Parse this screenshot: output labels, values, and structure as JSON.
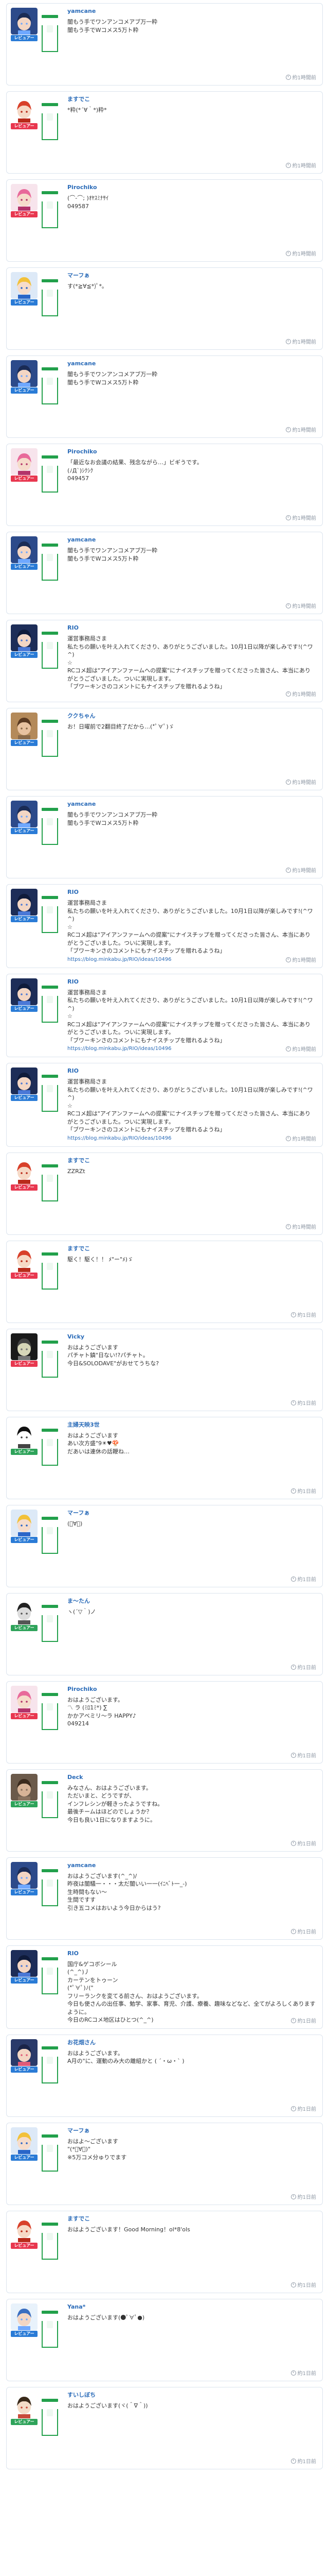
{
  "feed": {
    "posts": [
      {
        "user": "yamcane",
        "rank": "レビュアー",
        "rank_color": "blue",
        "avatar": "anime-blue",
        "msg": "闇もう手でワンアンコメアブ万一粋\n闇もう手でWコメス5万ト粋",
        "link": "",
        "ts": "約1時間前"
      },
      {
        "user": "ますでこ",
        "rank": "レビュアー",
        "rank_color": "red",
        "avatar": "red-hair",
        "msg": "*粋(*´∀｀*)粋*",
        "link": "",
        "ts": "約1時間前"
      },
      {
        "user": "Pirochiko",
        "rank": "レビュアー",
        "rank_color": "red",
        "avatar": "anime-pink",
        "msg": "(⌒-⌒; )ｵﾔｽﾐﾅｻｲ\n049587",
        "link": "",
        "ts": "約1時間前"
      },
      {
        "user": "マーフぁ",
        "rank": "レビュアー",
        "rank_color": "blue",
        "avatar": "anime-yellow",
        "msg": "す(*≧∀≦*)ﾟ*｡",
        "link": "",
        "ts": "約1時間前"
      },
      {
        "user": "yamcane",
        "rank": "レビュアー",
        "rank_color": "blue",
        "avatar": "anime-blue",
        "msg": "闇もう手でワンアンコメアブ万一粋\n闇もう手でWコメス5万ト粋",
        "link": "",
        "ts": "約1時間前"
      },
      {
        "user": "Pirochiko",
        "rank": "レビュアー",
        "rank_color": "red",
        "avatar": "anime-pink",
        "msg": "「最近なお会議の結果、残念ながら…」ビギうです。\n(ﾉД`)ｼｸｼｸ\n049457",
        "link": "",
        "ts": "約1時間前"
      },
      {
        "user": "yamcane",
        "rank": "レビュアー",
        "rank_color": "blue",
        "avatar": "anime-blue",
        "msg": "闇もう手でワンアンコメアブ万一粋\n闇もう手でWコメス5万ト粋",
        "link": "",
        "ts": "約1時間前"
      },
      {
        "user": "RIO",
        "rank": "レビュアー",
        "rank_color": "blue",
        "avatar": "anime-navy",
        "msg": "運営事務局さま\n私たちの願いを叶え入れてくださり、ありがとうございました。10月1日以降が楽しみです!(^ワ^)\n☆\nRCコメ超は\"アイアンファームへの提案\"にナイスチップを贈ってくださった皆さん、本当にありがとうございました。ついに実現します。\n「ブワーキンさのコメントにもナイスチップを贈れるようね」",
        "link": "",
        "ts": "約1時間前"
      },
      {
        "user": "ククちゃん",
        "rank": "レビュアー",
        "rank_color": "blue",
        "avatar": "photo-child",
        "msg": "お！日曜前で2翻目終了だから…(*ﾟ∀ﾟ)ゞ",
        "link": "",
        "ts": "約1時間前"
      },
      {
        "user": "yamcane",
        "rank": "レビュアー",
        "rank_color": "blue",
        "avatar": "anime-blue",
        "msg": "闇もう手でワンアンコメアブ万一粋\n闇もう手でWコメス5万ト粋",
        "link": "",
        "ts": "約1時間前"
      },
      {
        "user": "RIO",
        "rank": "レビュアー",
        "rank_color": "blue",
        "avatar": "anime-navy",
        "msg": "運営事務局さま\n私たちの願いを叶え入れてくださり、ありがとうございました。10月1日以降が楽しみです!(^ワ^)\n☆\nRCコメ超は\"アイアンファームへの提案\"にナイスチップを贈ってくださった皆さん、本当にありがとうございました。ついに実現します。\n「ブワーキンさのコメントにもナイスチップを贈れるようね」",
        "link": "https://blog.minkabu.jp/RIO/ideas/10496",
        "ts": "約1時間前"
      },
      {
        "user": "RIO",
        "rank": "レビュアー",
        "rank_color": "blue",
        "avatar": "anime-navy",
        "msg": "運営事務局さま\n私たちの願いを叶え入れてくださり、ありがとうございました。10月1日以降が楽しみです!(^ワ^)\n☆\nRCコメ超は\"アイアンファームへの提案\"にナイスチップを贈ってくださった皆さん、本当にありがとうございました。ついに実現します。\n「ブワーキンさのコメントにもナイスチップを贈れるようね」",
        "link": "https://blog.minkabu.jp/RIO/ideas/10496",
        "ts": "約1時間前"
      },
      {
        "user": "RIO",
        "rank": "レビュアー",
        "rank_color": "blue",
        "avatar": "anime-navy",
        "msg": "運営事務局さま\n私たちの願いを叶え入れてくださり、ありがとうございました。10月1日以降が楽しみです!(^ワ^)\n☆\nRCコメ超は\"アイアンファームへの提案\"にナイスチップを贈ってくださった皆さん、本当にありがとうございました。ついに実現します。\n「ブワーキンさのコメントにもナイスチップを贈れるようね」",
        "link": "https://blog.minkabu.jp/RIO/ideas/10496",
        "ts": "約1時間前"
      },
      {
        "user": "ますでこ",
        "rank": "レビュアー",
        "rank_color": "red",
        "avatar": "red-hair",
        "msg": "ZZRZt",
        "link": "",
        "ts": "約1時間前"
      },
      {
        "user": "ますでこ",
        "rank": "レビュアー",
        "rank_color": "red",
        "avatar": "red-hair",
        "msg": "駆く！駆く！！ ﾒ\"ー\"ﾒ)ゞ",
        "link": "",
        "ts": "約1日前"
      },
      {
        "user": "Vicky",
        "rank": "レビュアー",
        "rank_color": "red",
        "avatar": "dark-moon",
        "msg": "おはようございます\nパチャト鎮\"日ない!?パチャト。\n今日&SOLODAVE\"がおせてうちな?",
        "link": "",
        "ts": "約1日前"
      },
      {
        "user": "主婦天映3世",
        "rank": "レビュアー",
        "rank_color": "green",
        "avatar": "bw-creature",
        "msg": "おはようございます\nあい次方盛\"9☀♥🍄\nだあいは連休の話鞭ね…",
        "link": "",
        "ts": "約1日前"
      },
      {
        "user": "マーフぁ",
        "rank": "レビュアー",
        "rank_color": "blue",
        "avatar": "anime-yellow",
        "msg": "(ﾟ∀ﾟ)",
        "link": "",
        "ts": "約1日前"
      },
      {
        "user": "ま〜たん",
        "rank": "レビュアー",
        "rank_color": "green",
        "avatar": "bw-godzilla",
        "msg": "ヽ(´▽｀)ノ",
        "link": "",
        "ts": "約1日前"
      },
      {
        "user": "Pirochiko",
        "rank": "レビュアー",
        "rank_color": "red",
        "avatar": "anime-pink",
        "msg": "おはようございます。\n〽 ラ (ﾐﾛ1ﾐ*) ∑\nかかアベミリ〜ラ HAPPY♪\n049214",
        "link": "",
        "ts": "約1日前"
      },
      {
        "user": "Deck",
        "rank": "レビュアー",
        "rank_color": "green",
        "avatar": "photo-man",
        "msg": "みなさん、おはようございます。\nただいまと、どうですが、\nインフレシンが軽きったようですね。\n最後チームはほどのでしょうか？\n今日も良い1日になりますように。",
        "link": "",
        "ts": "約1日前"
      },
      {
        "user": "yamcane",
        "rank": "レビュアー",
        "rank_color": "blue",
        "avatar": "anime-blue",
        "msg": "おはようございます(^_^)/\n昨夜は闇騒一・・・太だ闇いい一一(ｲﾆﾍﾞﾄ一_-)\n生時間もない〜\n生間ですす\n引き五コメはおいよう今日からはう?",
        "link": "",
        "ts": "約1日前"
      },
      {
        "user": "RIO",
        "rank": "レビュアー",
        "rank_color": "blue",
        "avatar": "anime-navy",
        "msg": "国庁&ゲコボシール\n(^_^)丿\nカーテンをトゥーン\n(*ﾟ∀ﾟ)ﾉ(\"\nフリーランクを変てる前さん、おはようございます。\n今日も使さんの出任事、勉学、家事、育児、介護、療養、趣味などなど、全てがよろしくありますように。\n今日のRCコメ地区はひとつ(^_^)",
        "link": "",
        "ts": "約1日前"
      },
      {
        "user": "お花畑さん",
        "rank": "レビュアー",
        "rank_color": "blue",
        "avatar": "anime-group",
        "msg": "おはようございます。\nA月の\"に、運動のみ大の離組かと ( ´・ω・` )",
        "link": "",
        "ts": "約1日前"
      },
      {
        "user": "マーフぁ",
        "rank": "レビュアー",
        "rank_color": "blue",
        "avatar": "anime-yellow",
        "msg": "おはよ〜ございます\n\"(*ﾟ∀ﾟ)\"\n※5万コメ分ゅりでます",
        "link": "",
        "ts": "約1日前"
      },
      {
        "user": "ますでこ",
        "rank": "レビュアー",
        "rank_color": "red",
        "avatar": "red-hair",
        "msg": "おはようございます！Good Morning！ol*8'ols",
        "link": "",
        "ts": "約1日前"
      },
      {
        "user": "Yana*",
        "rank": "レビュアー",
        "rank_color": "blue",
        "avatar": "anime-sky",
        "msg": "おはようございます(●ﾟ∀ﾟ●)",
        "link": "",
        "ts": "約1日前"
      },
      {
        "user": "すいしぼち",
        "rank": "レビュアー",
        "rank_color": "green",
        "avatar": "anime-boy",
        "msg": "おはようございます(ヾ(＾∇＾))",
        "link": "",
        "ts": "約1日前"
      }
    ]
  }
}
